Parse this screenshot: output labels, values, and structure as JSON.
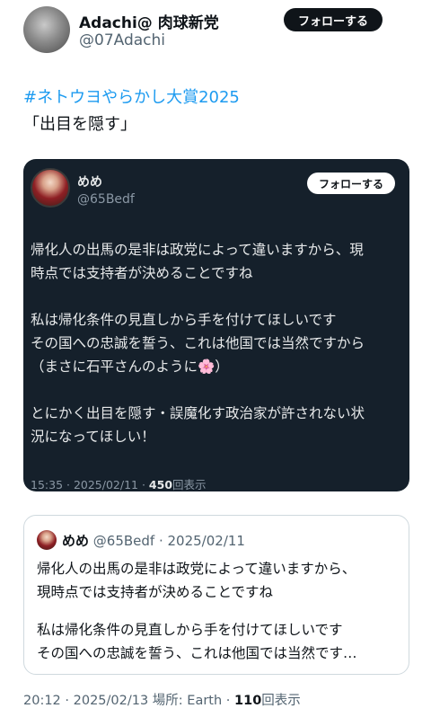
{
  "author": {
    "display_name": "Adachi@ 肉球新党",
    "handle": "@07Adachi",
    "follow_label": "フォローする"
  },
  "post": {
    "hashtag": "#ネトウヨやらかし大賞2025",
    "text": "「出目を隠す」"
  },
  "embedded": {
    "name": "めめ",
    "handle": "@65Bedf",
    "follow_label": "フォローする",
    "lines": [
      "帰化人の出馬の是非は政党によって違いますから、現",
      "時点では支持者が決めることですね",
      "",
      "私は帰化条件の見直しから手を付けてほしいです",
      "その国への忠誠を誓う、これは他国では当然ですから",
      "（まさに石平さんのように🌸）",
      "",
      "とにかく出目を隠す・誤魔化す政治家が許されない状",
      "況になってほしい！"
    ],
    "meta_time": "15:35 · 2025/02/11 · ",
    "meta_views": "450",
    "meta_views_label": "回表示"
  },
  "quote": {
    "name": "めめ",
    "handle_date": "@65Bedf · 2025/02/11",
    "lines": [
      "帰化人の出馬の是非は政党によって違いますから、",
      "現時点では支持者が決めることですね",
      "",
      "私は帰化条件の見直しから手を付けてほしいです",
      "その国への忠誠を誓う、これは他国では当然です…"
    ]
  },
  "footer": {
    "time": "20:12 · 2025/02/13 場所: Earth · ",
    "views": "110",
    "views_label": "回表示"
  }
}
